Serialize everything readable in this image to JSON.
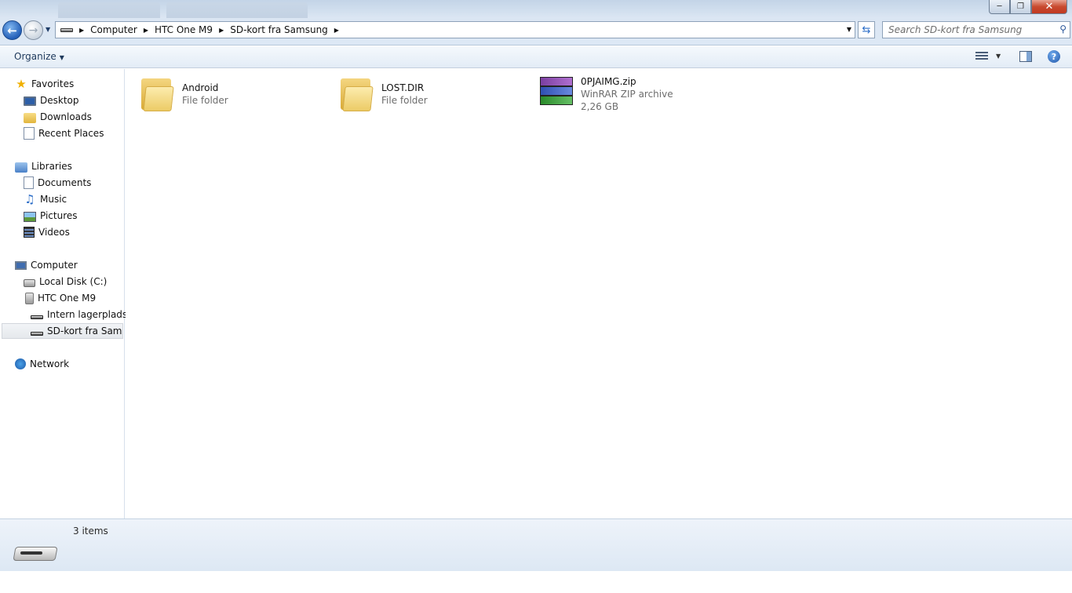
{
  "window": {
    "caption_buttons": [
      "minimize",
      "restore",
      "close"
    ]
  },
  "address": {
    "segments": [
      "Computer",
      "HTC One M9",
      "SD-kort fra Samsung"
    ],
    "search_placeholder": "Search SD-kort fra Samsung"
  },
  "commandbar": {
    "organize_label": "Organize",
    "help_label": "?"
  },
  "navpane": {
    "favorites": {
      "label": "Favorites",
      "items": [
        {
          "label": "Desktop",
          "icon": "desktop-icon"
        },
        {
          "label": "Downloads",
          "icon": "downloads-folder-icon"
        },
        {
          "label": "Recent Places",
          "icon": "recent-places-icon"
        }
      ]
    },
    "libraries": {
      "label": "Libraries",
      "items": [
        {
          "label": "Documents",
          "icon": "documents-icon"
        },
        {
          "label": "Music",
          "icon": "music-icon"
        },
        {
          "label": "Pictures",
          "icon": "pictures-icon"
        },
        {
          "label": "Videos",
          "icon": "videos-icon"
        }
      ]
    },
    "computer": {
      "label": "Computer",
      "items": [
        {
          "label": "Local Disk (C:)",
          "icon": "local-disk-icon"
        },
        {
          "label": "HTC One M9",
          "icon": "phone-icon"
        },
        {
          "label": "Intern lagerplads",
          "icon": "drive-icon"
        },
        {
          "label": "SD-kort fra Samsu",
          "icon": "drive-icon",
          "selected": true
        }
      ]
    },
    "network": {
      "label": "Network"
    }
  },
  "content": {
    "items": [
      {
        "name": "Android",
        "type": "File folder",
        "icon": "folder-icon"
      },
      {
        "name": "LOST.DIR",
        "type": "File folder",
        "icon": "folder-icon"
      },
      {
        "name": "0PJAIMG.zip",
        "type": "WinRAR ZIP archive",
        "size": "2,26 GB",
        "icon": "winrar-archive-icon"
      }
    ]
  },
  "details": {
    "count": "3 items"
  },
  "colors": {
    "accent": "#2560b8",
    "selected_bg": "#e5e8ec",
    "details_bg": "#dde8f4"
  }
}
